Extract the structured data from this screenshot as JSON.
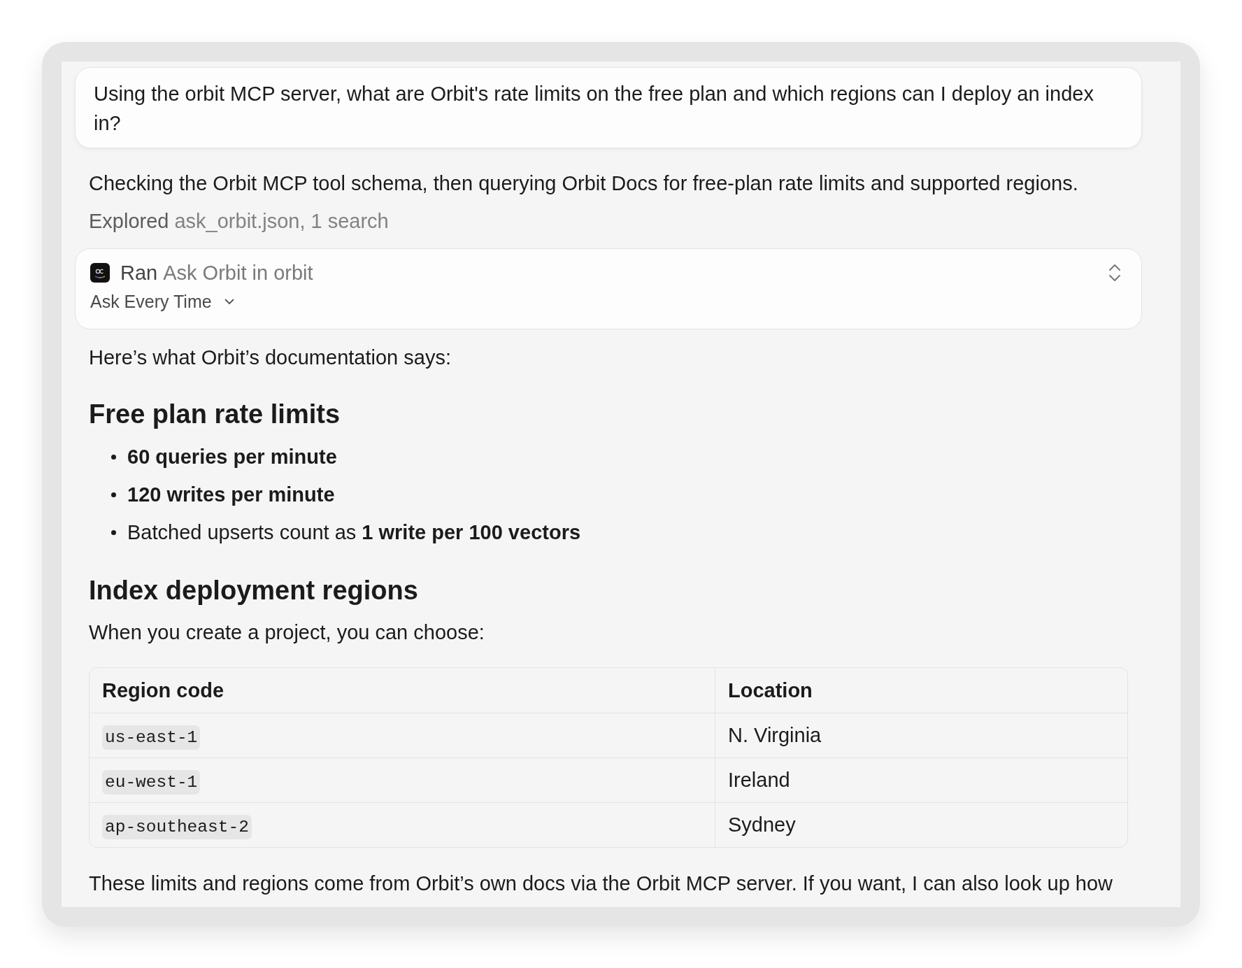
{
  "prompt": {
    "text": "Using the orbit MCP server, what are Orbit's rate limits on the free plan and which regions can I deploy an index in?"
  },
  "status_text": "Checking the Orbit MCP tool schema, then querying Orbit Docs for free-plan rate limits and supported regions.",
  "explored": {
    "label": "Explored",
    "detail": "ask_orbit.json, 1 search"
  },
  "tool_call": {
    "verb": "Ran",
    "name": "Ask Orbit in orbit",
    "permission": "Ask Every Time"
  },
  "answer": [
    {
      "kind": "paragraph",
      "text": "Here’s what Orbit’s documentation says:"
    },
    {
      "kind": "heading",
      "text": "Free plan rate limits"
    },
    {
      "kind": "list",
      "items": [
        "**60 queries per minute**",
        "**120 writes per minute**",
        "Batched upserts count as **1 write per 100 vectors**"
      ]
    },
    {
      "kind": "heading",
      "text": "Index deployment regions"
    },
    {
      "kind": "paragraph",
      "text": "When you create a project, you can choose:"
    },
    {
      "kind": "table",
      "columns": [
        "Region code",
        "Location"
      ],
      "rows": [
        [
          {
            "text": "us-east-1",
            "code": true
          },
          {
            "text": "N. Virginia",
            "code": false
          }
        ],
        [
          {
            "text": "eu-west-1",
            "code": true
          },
          {
            "text": "Ireland",
            "code": false
          }
        ],
        [
          {
            "text": "ap-southeast-2",
            "code": true
          },
          {
            "text": "Sydney",
            "code": false
          }
        ]
      ]
    },
    {
      "kind": "closing",
      "text": "These limits and regions come from Orbit’s own docs via the Orbit MCP server. If you want, I can also look up how"
    }
  ]
}
